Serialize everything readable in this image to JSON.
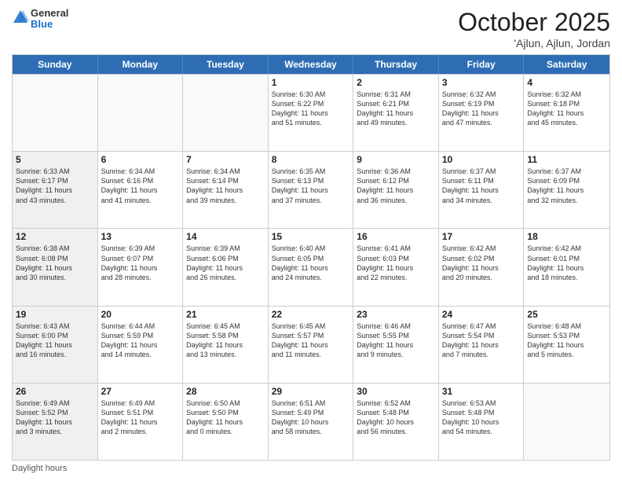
{
  "header": {
    "logo_general": "General",
    "logo_blue": "Blue",
    "month": "October 2025",
    "location": "'Ajlun, Ajlun, Jordan"
  },
  "days_of_week": [
    "Sunday",
    "Monday",
    "Tuesday",
    "Wednesday",
    "Thursday",
    "Friday",
    "Saturday"
  ],
  "footer": {
    "daylight_hours": "Daylight hours"
  },
  "weeks": [
    [
      {
        "day": "",
        "info": "",
        "shaded": true
      },
      {
        "day": "",
        "info": "",
        "shaded": true
      },
      {
        "day": "",
        "info": "",
        "shaded": true
      },
      {
        "day": "1",
        "info": "Sunrise: 6:30 AM\nSunset: 6:22 PM\nDaylight: 11 hours\nand 51 minutes.",
        "shaded": false
      },
      {
        "day": "2",
        "info": "Sunrise: 6:31 AM\nSunset: 6:21 PM\nDaylight: 11 hours\nand 49 minutes.",
        "shaded": false
      },
      {
        "day": "3",
        "info": "Sunrise: 6:32 AM\nSunset: 6:19 PM\nDaylight: 11 hours\nand 47 minutes.",
        "shaded": false
      },
      {
        "day": "4",
        "info": "Sunrise: 6:32 AM\nSunset: 6:18 PM\nDaylight: 11 hours\nand 45 minutes.",
        "shaded": false
      }
    ],
    [
      {
        "day": "5",
        "info": "Sunrise: 6:33 AM\nSunset: 6:17 PM\nDaylight: 11 hours\nand 43 minutes.",
        "shaded": true
      },
      {
        "day": "6",
        "info": "Sunrise: 6:34 AM\nSunset: 6:16 PM\nDaylight: 11 hours\nand 41 minutes.",
        "shaded": false
      },
      {
        "day": "7",
        "info": "Sunrise: 6:34 AM\nSunset: 6:14 PM\nDaylight: 11 hours\nand 39 minutes.",
        "shaded": false
      },
      {
        "day": "8",
        "info": "Sunrise: 6:35 AM\nSunset: 6:13 PM\nDaylight: 11 hours\nand 37 minutes.",
        "shaded": false
      },
      {
        "day": "9",
        "info": "Sunrise: 6:36 AM\nSunset: 6:12 PM\nDaylight: 11 hours\nand 36 minutes.",
        "shaded": false
      },
      {
        "day": "10",
        "info": "Sunrise: 6:37 AM\nSunset: 6:11 PM\nDaylight: 11 hours\nand 34 minutes.",
        "shaded": false
      },
      {
        "day": "11",
        "info": "Sunrise: 6:37 AM\nSunset: 6:09 PM\nDaylight: 11 hours\nand 32 minutes.",
        "shaded": false
      }
    ],
    [
      {
        "day": "12",
        "info": "Sunrise: 6:38 AM\nSunset: 6:08 PM\nDaylight: 11 hours\nand 30 minutes.",
        "shaded": true
      },
      {
        "day": "13",
        "info": "Sunrise: 6:39 AM\nSunset: 6:07 PM\nDaylight: 11 hours\nand 28 minutes.",
        "shaded": false
      },
      {
        "day": "14",
        "info": "Sunrise: 6:39 AM\nSunset: 6:06 PM\nDaylight: 11 hours\nand 26 minutes.",
        "shaded": false
      },
      {
        "day": "15",
        "info": "Sunrise: 6:40 AM\nSunset: 6:05 PM\nDaylight: 11 hours\nand 24 minutes.",
        "shaded": false
      },
      {
        "day": "16",
        "info": "Sunrise: 6:41 AM\nSunset: 6:03 PM\nDaylight: 11 hours\nand 22 minutes.",
        "shaded": false
      },
      {
        "day": "17",
        "info": "Sunrise: 6:42 AM\nSunset: 6:02 PM\nDaylight: 11 hours\nand 20 minutes.",
        "shaded": false
      },
      {
        "day": "18",
        "info": "Sunrise: 6:42 AM\nSunset: 6:01 PM\nDaylight: 11 hours\nand 18 minutes.",
        "shaded": false
      }
    ],
    [
      {
        "day": "19",
        "info": "Sunrise: 6:43 AM\nSunset: 6:00 PM\nDaylight: 11 hours\nand 16 minutes.",
        "shaded": true
      },
      {
        "day": "20",
        "info": "Sunrise: 6:44 AM\nSunset: 5:59 PM\nDaylight: 11 hours\nand 14 minutes.",
        "shaded": false
      },
      {
        "day": "21",
        "info": "Sunrise: 6:45 AM\nSunset: 5:58 PM\nDaylight: 11 hours\nand 13 minutes.",
        "shaded": false
      },
      {
        "day": "22",
        "info": "Sunrise: 6:45 AM\nSunset: 5:57 PM\nDaylight: 11 hours\nand 11 minutes.",
        "shaded": false
      },
      {
        "day": "23",
        "info": "Sunrise: 6:46 AM\nSunset: 5:55 PM\nDaylight: 11 hours\nand 9 minutes.",
        "shaded": false
      },
      {
        "day": "24",
        "info": "Sunrise: 6:47 AM\nSunset: 5:54 PM\nDaylight: 11 hours\nand 7 minutes.",
        "shaded": false
      },
      {
        "day": "25",
        "info": "Sunrise: 6:48 AM\nSunset: 5:53 PM\nDaylight: 11 hours\nand 5 minutes.",
        "shaded": false
      }
    ],
    [
      {
        "day": "26",
        "info": "Sunrise: 6:49 AM\nSunset: 5:52 PM\nDaylight: 11 hours\nand 3 minutes.",
        "shaded": true
      },
      {
        "day": "27",
        "info": "Sunrise: 6:49 AM\nSunset: 5:51 PM\nDaylight: 11 hours\nand 2 minutes.",
        "shaded": false
      },
      {
        "day": "28",
        "info": "Sunrise: 6:50 AM\nSunset: 5:50 PM\nDaylight: 11 hours\nand 0 minutes.",
        "shaded": false
      },
      {
        "day": "29",
        "info": "Sunrise: 6:51 AM\nSunset: 5:49 PM\nDaylight: 10 hours\nand 58 minutes.",
        "shaded": false
      },
      {
        "day": "30",
        "info": "Sunrise: 6:52 AM\nSunset: 5:48 PM\nDaylight: 10 hours\nand 56 minutes.",
        "shaded": false
      },
      {
        "day": "31",
        "info": "Sunrise: 6:53 AM\nSunset: 5:48 PM\nDaylight: 10 hours\nand 54 minutes.",
        "shaded": false
      },
      {
        "day": "",
        "info": "",
        "shaded": true
      }
    ]
  ]
}
